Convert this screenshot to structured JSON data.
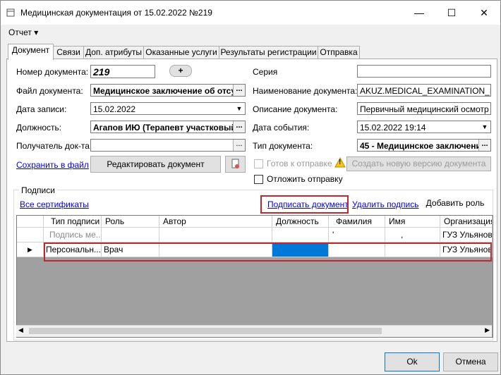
{
  "window": {
    "title": "Медицинская документация от 15.02.2022 №219",
    "minimize_icon": "minimize-icon",
    "maximize_icon": "maximize-icon",
    "close_icon": "close-icon",
    "minimize_glyph": "—",
    "maximize_glyph": "☐",
    "close_glyph": "✕"
  },
  "menu": {
    "report_label": "Отчет ▾"
  },
  "tabs": [
    {
      "label": "Документ",
      "active": true
    },
    {
      "label": "Связи"
    },
    {
      "label": "Доп. атрибуты"
    },
    {
      "label": "Оказанные услуги"
    },
    {
      "label": "Результаты регистрации"
    },
    {
      "label": "Отправка"
    }
  ],
  "form": {
    "doc_number_label": "Номер документа:",
    "doc_number_value": "219",
    "plus_label": "+",
    "doc_file_label": "Файл документа:",
    "doc_file_value": "Медицинское заключение об отсу",
    "record_date_label": "Дата записи:",
    "record_date_value": "15.02.2022",
    "position_label": "Должность:",
    "position_value": "Агапов ИЮ (Терапевт участковый)",
    "recipient_label": "Получатель док-та",
    "recipient_value": "",
    "save_to_file": "Сохранить в файл",
    "edit_doc_button": "Редактировать документ",
    "series_label": "Серия",
    "series_value": "",
    "doc_name_label": "Наименование документа:",
    "doc_name_value": "AKUZ.MEDICAL_EXAMINATION_MAI",
    "doc_desc_label": "Описание документа:",
    "doc_desc_value": "Первичный медицинский осмотр",
    "event_date_label": "Дата события:",
    "event_date_value": "15.02.2022 19:14",
    "doc_type_label": "Тип документа:",
    "doc_type_value": "45 - Медицинское заключени",
    "ready_label": "Готов к отправке",
    "new_version_button": "Создать новую версию документа",
    "postpone_label": "Отложить отправку",
    "ellipsis": "...",
    "dropdown_arrow": "▼",
    "warning_glyph": "!"
  },
  "signatures": {
    "group_title": "Подписи",
    "all_certs": "Все сертификаты",
    "sign_doc": "Подписать документ",
    "delete_sign": "Удалить подпись",
    "add_role": "Добавить роль",
    "columns": [
      "Тип подписи",
      "Роль",
      "Автор",
      "Должность",
      "Фамилия",
      "Имя",
      "Организация"
    ],
    "rows": [
      {
        "type": "Подпись ме...",
        "role": "",
        "author": "",
        "position": "",
        "lastname": "'",
        "firstname": ",",
        "org": "ГУЗ Ульянов"
      },
      {
        "type": "Персональн...",
        "role": "Врач",
        "author": "",
        "position": "",
        "lastname": "",
        "firstname": "",
        "org": "ГУЗ Ульянов"
      }
    ],
    "row_pointer": "▶",
    "scroll_left": "◀",
    "scroll_right": "▶"
  },
  "footer": {
    "ok": "Ok",
    "cancel": "Отмена"
  },
  "colors": {
    "highlight_red": "#c0282d",
    "selection_blue": "#0078d7",
    "link_blue": "#0000ee"
  }
}
